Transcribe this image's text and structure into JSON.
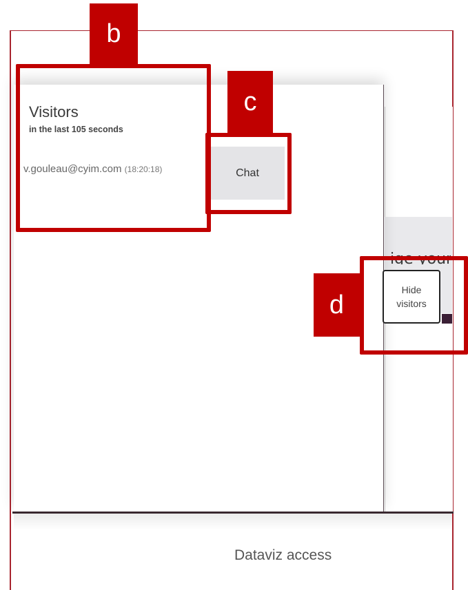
{
  "visitors_panel": {
    "title": "Visitors",
    "subtitle": "in the last 105 seconds",
    "visitor": {
      "email": "v.gouleau@cyim.com",
      "time": "(18:20:18)"
    },
    "chat_label": "Chat"
  },
  "background": {
    "cut_text": "ige your",
    "hide_button_label": "Hide visitors",
    "footer_link": "Dataviz access"
  },
  "annotations": {
    "b": "b",
    "c": "c",
    "d": "d"
  },
  "colors": {
    "annotation_red": "#c00000",
    "frame_red": "#a8242e",
    "chat_button_bg": "#e4e4e7"
  }
}
